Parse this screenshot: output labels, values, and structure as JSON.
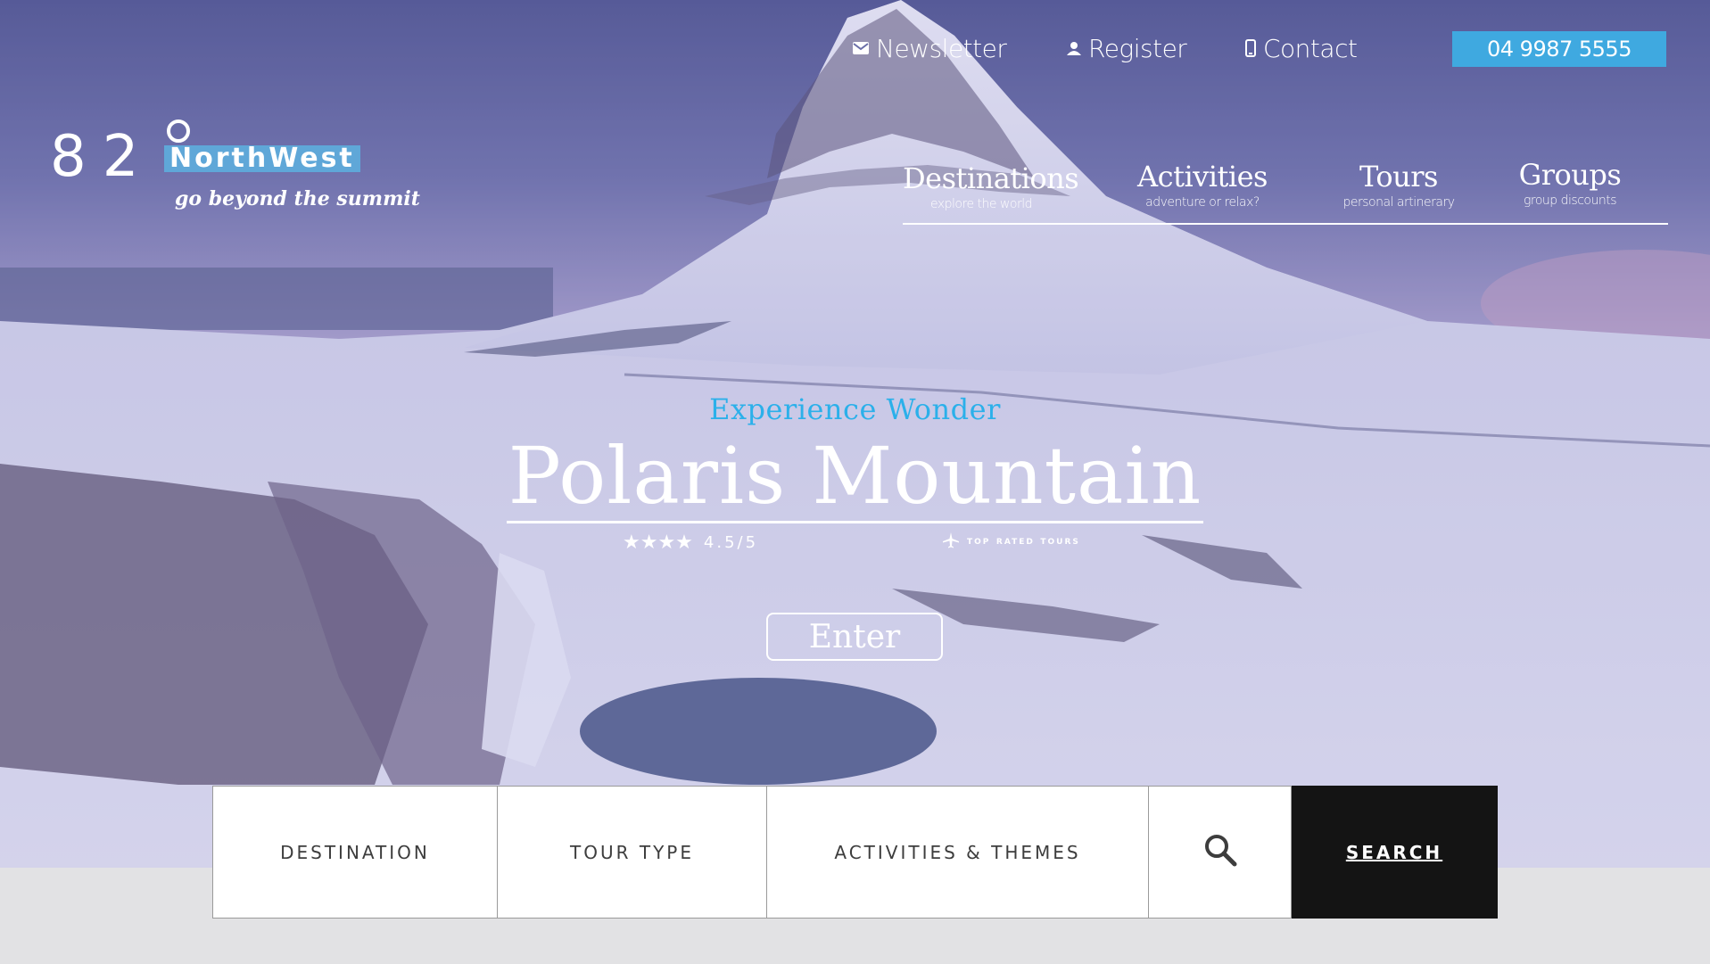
{
  "topbar": {
    "newsletter": {
      "label": "Newsletter",
      "icon": "envelope-icon"
    },
    "register": {
      "label": "Register",
      "icon": "user-icon"
    },
    "contact": {
      "label": "Contact",
      "icon": "phone-icon"
    },
    "phone": "04 9987 5555"
  },
  "logo": {
    "number": "82",
    "brand": "NorthWest",
    "tagline": "go beyond the summit"
  },
  "nav": [
    {
      "title": "Destinations",
      "subtitle": "explore the world"
    },
    {
      "title": "Activities",
      "subtitle": "adventure or relax?"
    },
    {
      "title": "Tours",
      "subtitle": "personal artinerary"
    },
    {
      "title": "Groups",
      "subtitle": "group discounts"
    }
  ],
  "hero": {
    "eyebrow": "Experience Wonder",
    "title": "Polaris Mountain",
    "stars": "★★★★",
    "rating": "4.5/5",
    "badge": "top rated tours",
    "cta": "Enter"
  },
  "search": {
    "destination": "DESTINATION",
    "tour_type": "TOUR TYPE",
    "activities": "ACTIVITIES & THEMES",
    "icon": "search-icon",
    "button": "SEARCH"
  },
  "colors": {
    "accent": "#3fa9e0",
    "eyebrow": "#2bb0ea",
    "search_button": "#141414"
  }
}
